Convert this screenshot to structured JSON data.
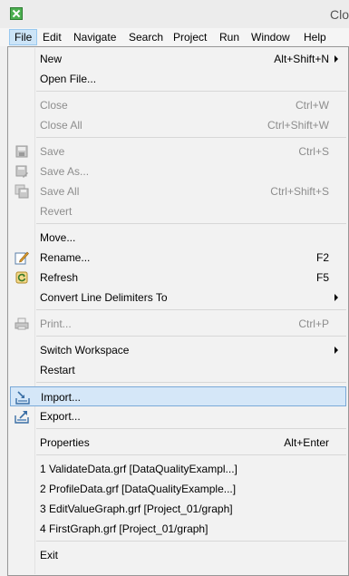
{
  "window": {
    "title": "Clo"
  },
  "menubar": {
    "items": [
      "File",
      "Edit",
      "Navigate",
      "Search",
      "Project",
      "Run",
      "Window",
      "Help"
    ]
  },
  "menu": {
    "new": {
      "label": "New",
      "shortcut": "Alt+Shift+N"
    },
    "open_file": {
      "label": "Open File..."
    },
    "close": {
      "label": "Close",
      "shortcut": "Ctrl+W"
    },
    "close_all": {
      "label": "Close All",
      "shortcut": "Ctrl+Shift+W"
    },
    "save": {
      "label": "Save",
      "shortcut": "Ctrl+S"
    },
    "save_as": {
      "label": "Save As..."
    },
    "save_all": {
      "label": "Save All",
      "shortcut": "Ctrl+Shift+S"
    },
    "revert": {
      "label": "Revert"
    },
    "move": {
      "label": "Move..."
    },
    "rename": {
      "label": "Rename...",
      "shortcut": "F2"
    },
    "refresh": {
      "label": "Refresh",
      "shortcut": "F5"
    },
    "convert": {
      "label": "Convert Line Delimiters To"
    },
    "print": {
      "label": "Print...",
      "shortcut": "Ctrl+P"
    },
    "switch_workspace": {
      "label": "Switch Workspace"
    },
    "restart": {
      "label": "Restart"
    },
    "import": {
      "label": "Import..."
    },
    "export": {
      "label": "Export..."
    },
    "properties": {
      "label": "Properties",
      "shortcut": "Alt+Enter"
    },
    "recent": [
      "1 ValidateData.grf  [DataQualityExampl...]",
      "2 ProfileData.grf  [DataQualityExample...]",
      "3 EditValueGraph.grf  [Project_01/graph]",
      "4 FirstGraph.grf  [Project_01/graph]"
    ],
    "exit": {
      "label": "Exit"
    }
  },
  "icons": {
    "app": "clover-icon",
    "save": "save-icon",
    "save_as": "save-as-icon",
    "save_all": "save-all-icon",
    "rename": "rename-icon",
    "refresh": "refresh-icon",
    "print": "print-icon",
    "import": "import-icon",
    "export": "export-icon"
  },
  "colors": {
    "highlight": "#d5e7f8",
    "highlight_border": "#7aa9d8",
    "active_menu": "#cce4f7"
  }
}
